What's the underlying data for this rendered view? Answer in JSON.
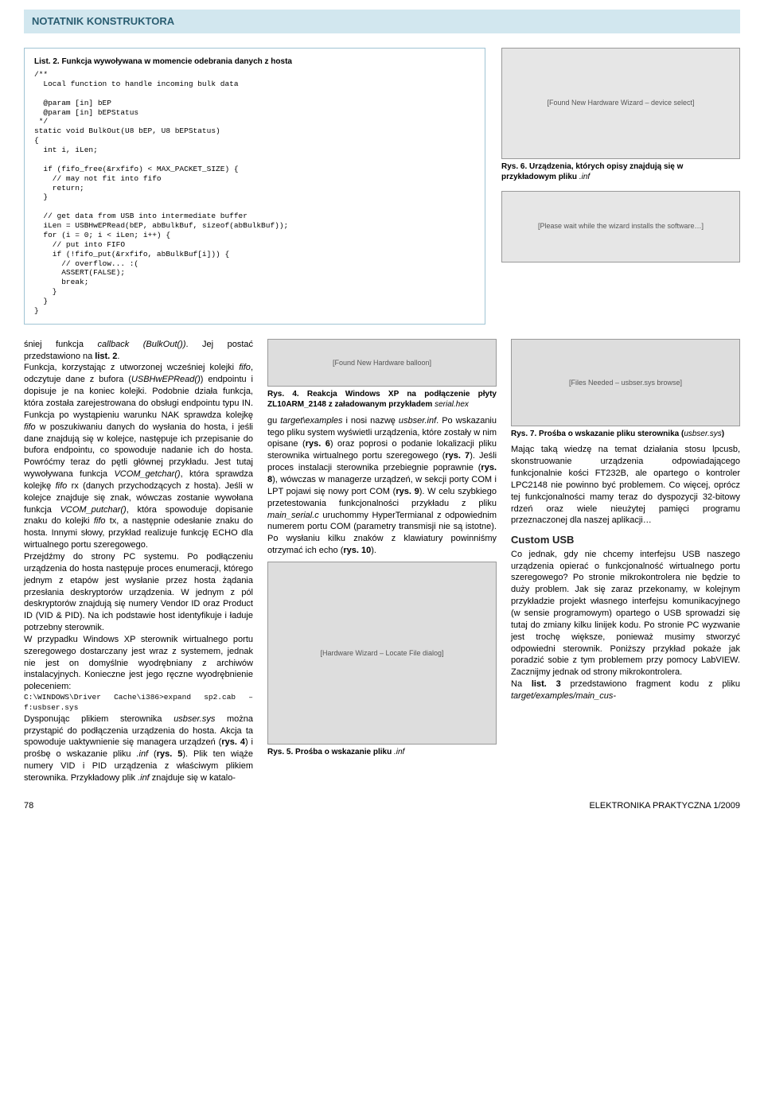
{
  "header": {
    "title": "NOTATNIK KONSTRUKTORA"
  },
  "listing2": {
    "title": "List. 2. Funkcja wywoływana w momencie odebrania danych z hosta",
    "code": "/**\n  Local function to handle incoming bulk data\n\n  @param [in] bEP\n  @param [in] bEPStatus\n */\nstatic void BulkOut(U8 bEP, U8 bEPStatus)\n{\n  int i, iLen;\n\n  if (fifo_free(&rxfifo) < MAX_PACKET_SIZE) {\n    // may not fit into fifo\n    return;\n  }\n\n  // get data from USB into intermediate buffer\n  iLen = USBHwEPRead(bEP, abBulkBuf, sizeof(abBulkBuf));\n  for (i = 0; i < iLen; i++) {\n    // put into FIFO\n    if (!fifo_put(&rxfifo, abBulkBuf[i])) {\n      // overflow... :(\n      ASSERT(FALSE);\n      break;\n    }\n  }\n}"
  },
  "fig6": {
    "ph": "[Found New Hardware Wizard – device select]",
    "caption_bold": "Rys. 6. Urządzenia, których opisy znajdują się w przykładowym pliku ",
    "caption_ital": ".inf"
  },
  "fig_wait": {
    "ph": "[Please wait while the wizard installs the software…]"
  },
  "body": {
    "p1a": "śniej funkcja ",
    "p1b": "callback (BulkOut())",
    "p1c": ". Jej postać przedstawiono na ",
    "p1d": "list. 2",
    "p1e": ".",
    "p2a": "Funkcja, korzystając z utworzonej wcześniej kolejki ",
    "p2b": "fifo",
    "p2c": ", odczytuje dane z bufora (",
    "p2d": "USBHwEPRead()",
    "p2e": ") endpointu i dopisuje je na koniec kolejki. Podobnie działa funkcja, która została zarejestrowana do obsługi endpointu typu IN. Funkcja po wystąpieniu warunku NAK sprawdza kolejkę ",
    "p2f": "fifo",
    "p2g": " w poszukiwaniu danych do wysłania do hosta, i jeśli dane znajdują się w kolejce, następuje ich przepisanie do bufora endpointu, co spowoduje nadanie ich do hosta. Powróćmy teraz do pętli głównej przykładu. Jest tutaj wywoływana funkcja ",
    "p2h": "VCOM_getchar()",
    "p2i": ", która sprawdza kolejkę ",
    "p2j": "fifo",
    "p2k": " rx (danych przychodzących z hosta). Jeśli w kolejce znajduje się znak, wówczas zostanie wywołana funkcja ",
    "p2l": "VCOM_putchar()",
    "p2m": ", która spowoduje dopisanie znaku do kolejki ",
    "p2n": "fifo",
    "p2o": " tx, a następnie odesłanie znaku do hosta. Innymi słowy, przykład realizuje funkcję ECHO dla wirtualnego portu szeregowego.",
    "p3": "Przejdźmy do strony PC systemu. Po podłączeniu urządzenia do hosta następuje proces enumeracji, którego jednym z etapów jest wysłanie przez hosta żądania przesłania deskryptorów urządzenia. W jednym z pól deskryptorów znajdują się numery Vendor ID oraz Product ID (VID & PID). Na ich podstawie host identyfikuje i ładuje potrzebny sterownik.",
    "p4": "W przypadku Windows XP sterownik wirtualnego portu szeregowego dostarczany jest wraz z systemem, jednak nie jest on domyślnie wyodrębniany z archiwów instalacyjnych. Konieczne jest jego ręczne wyodrębnienie poleceniem:",
    "cmd": "C:\\WINDOWS\\Driver Cache\\i386>expand sp2.cab –f:usbser.sys",
    "p5a": "Dysponując plikiem sterownika ",
    "p5b": "usbser.sys",
    "p5c": " można przystąpić do podłączenia urządzenia do hosta. Akcja ta spowoduje uaktywnienie się managera urządzeń (",
    "p5d": "rys. 4",
    "p5e": ") i prośbę o wskazanie pliku ",
    "p5f": ".inf",
    "p5g": " (",
    "p5h": "rys. 5",
    "p5i": "). Plik ten wiąże numery VID i PID urządzenia z właściwym plikiem sterownika. Przykładowy plik ",
    "p5j": ".inf",
    "p5k": " znajduje się w katalo-",
    "p6a": "gu ",
    "p6b": "target\\examples",
    "p6c": " i nosi nazwę ",
    "p6d": "usbser.inf",
    "p6e": ". Po wskazaniu tego pliku system wyświetli urządzenia, które zostały w nim opisane (",
    "p6f": "rys. 6",
    "p6g": ") oraz poprosi o podanie lokalizacji pliku sterownika wirtualnego portu szeregowego (",
    "p6h": "rys. 7",
    "p6i": "). Jeśli proces instalacji sterownika przebiegnie poprawnie (",
    "p6j": "rys. 8",
    "p6k": "), wówczas w managerze urządzeń, w sekcji porty COM i LPT pojawi się nowy port COM (",
    "p6l": "rys. 9",
    "p6m": "). W celu szybkiego przetestowania funkcjonalności przykładu z pliku ",
    "p6n": "main_serial.c",
    "p6o": " uruchommy HyperTermianal z odpowiednim numerem portu COM (parametry transmisji nie są istotne). Po wysłaniu kilku znaków z klawiatury powinniśmy otrzymać ich echo (",
    "p6p": "rys. 10",
    "p6q": ").",
    "p7": "Mając taką wiedzę na temat działania stosu lpcusb, skonstruowanie urządzenia odpowiadającego funkcjonalnie kości FT232B, ale opartego o kontroler LPC2148 nie powinno być problemem. Co więcej, oprócz tej funkcjonalności mamy teraz do dyspozycji 32-bitowy rdzeń oraz wiele nieużytej pamięci programu przeznaczonej dla naszej aplikacji…",
    "h_custom": "Custom USB",
    "p8": "Co jednak, gdy nie chcemy interfejsu USB naszego urządzenia opierać o funkcjonalność wirtualnego portu szeregowego? Po stronie mikrokontrolera nie będzie to duży problem. Jak się zaraz przekonamy, w kolejnym przykładzie projekt własnego interfejsu komunikacyjnego (w sensie programowym) opartego o USB sprowadzi się tutaj do zmiany kilku linijek kodu. Po stronie PC wyzwanie jest trochę większe, ponieważ musimy stworzyć odpowiedni sterownik. Poniższy przykład pokaże jak poradzić sobie z tym problemem przy pomocy LabVIEW. Zacznijmy jednak od strony mikrokontrolera.",
    "p9a": "Na ",
    "p9b": "list. 3",
    "p9c": " przedstawiono fragment kodu z pliku ",
    "p9d": "target/examples/main_cus-"
  },
  "fig4": {
    "ph": "[Found New Hardware balloon]",
    "cap_b": "Rys. 4. Reakcja Windows XP na podłączenie płyty ZL10ARM_2148 z załadowanym przykładem ",
    "cap_i": "serial.hex"
  },
  "fig5": {
    "ph": "[Hardware Wizard – Locate File dialog]",
    "cap_b": "Rys. 5. Prośba o wskazanie pliku ",
    "cap_i": ".inf"
  },
  "fig7": {
    "ph": "[Files Needed – usbser.sys browse]",
    "cap_b": "Rys. 7. Prośba o wskazanie pliku sterownika (",
    "cap_i": "usbser.sys",
    "cap_after": ")"
  },
  "footer": {
    "page": "78",
    "magazine": "ELEKTRONIKA PRAKTYCZNA 1/2009"
  }
}
